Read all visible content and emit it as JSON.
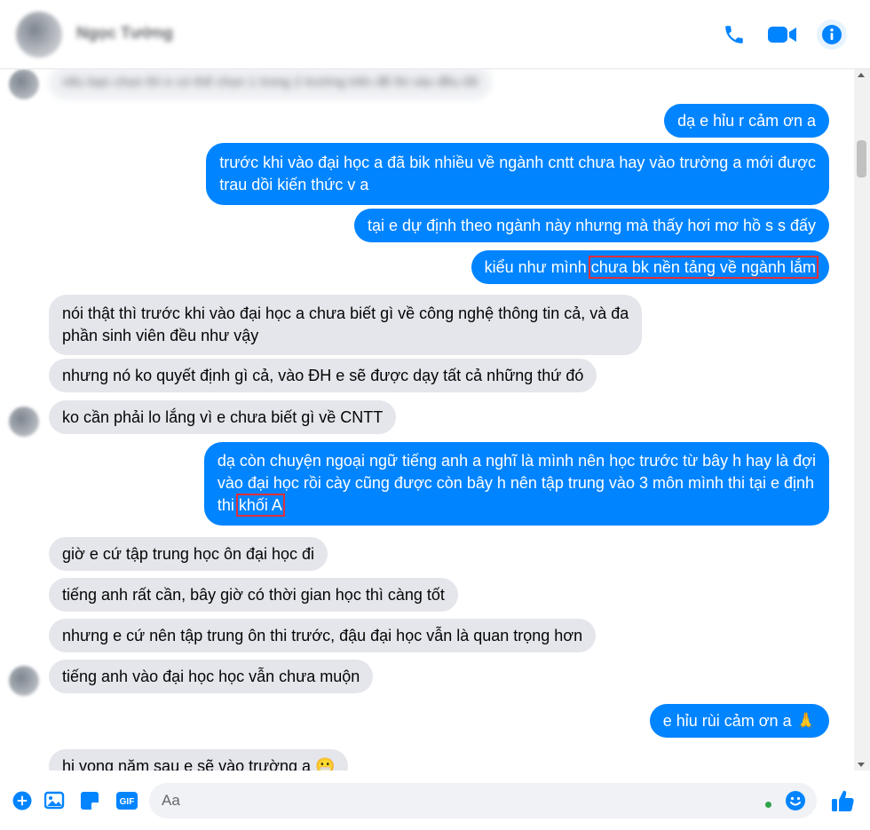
{
  "header": {
    "contact_name": "Ngọc Tường"
  },
  "chat": {
    "blurred_top_message": "nếu bạn chọn thì e có thể chọn 1 trong 2 trường trên để thi vào đều tốt",
    "messages": [
      {
        "text": "dạ e hỉu r cảm ơn a"
      },
      {
        "line1": "trước khi vào đại học a đã bik nhiều về ngành cntt chưa hay vào trường a mới được",
        "line2": "trau dồi kiến thức v a"
      },
      {
        "text": "tại e dự định theo ngành này nhưng mà thấy hơi mơ hồ s s đấy"
      },
      {
        "prefix": "kiểu như mình ",
        "highlight": "chưa bk nền tảng về ngành lắm"
      },
      {
        "line1": "nói thật thì trước khi vào đại học a chưa biết gì về công nghệ thông tin cả, và đa",
        "line2": "phần sinh viên đều như vậy"
      },
      {
        "text": "nhưng nó ko quyết định gì cả, vào ĐH e sẽ được dạy tất cả những thứ đó"
      },
      {
        "text": "ko cần phải lo lắng vì e chưa biết gì về CNTT"
      },
      {
        "line1": "dạ còn chuyện ngoại ngữ tiếng anh a nghĩ là mình nên học trước từ bây h hay là đợi",
        "line2": "vào đại học rồi cày cũng được còn bây h nên tập trung vào 3 môn mình thi tại e định",
        "line3_prefix": "thi ",
        "highlight": "khối A"
      },
      {
        "text": "giờ e cứ tập trung học ôn đại học đi"
      },
      {
        "text": "tiếng anh rất cần, bây giờ có thời gian học thì càng tốt"
      },
      {
        "text": "nhưng e cứ nên tập trung ôn thi trước, đậu đại học vẫn là quan trọng hơn"
      },
      {
        "text": "tiếng anh vào đại học học vẫn chưa muộn"
      },
      {
        "text": "e hỉu rùi cảm ơn a 🙏"
      },
      {
        "text": "hi vọng năm sau e sẽ vào trường a 😬"
      }
    ]
  },
  "composer": {
    "placeholder": "Aa"
  },
  "colors": {
    "accent": "#0084ff",
    "incoming_bubble": "#e4e6eb",
    "highlight_box": "#e0303a"
  }
}
